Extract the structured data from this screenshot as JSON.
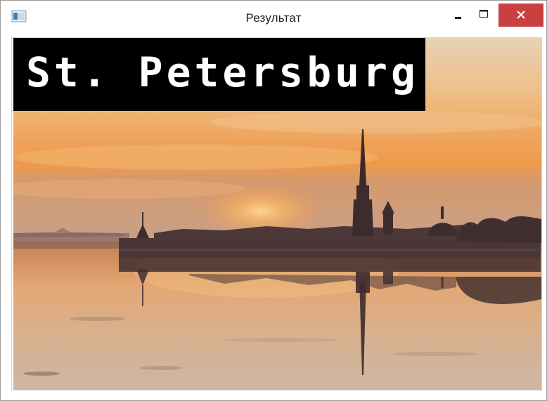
{
  "window": {
    "title": "Результат",
    "icon": "window-app-icon",
    "controls": {
      "minimize_icon": "minimize-icon",
      "maximize_icon": "maximize-icon",
      "close_icon": "close-icon",
      "close_color": "#c94040"
    }
  },
  "image": {
    "caption": "St. Petersburg",
    "caption_bg": "#000000",
    "caption_color": "#ffffff"
  }
}
